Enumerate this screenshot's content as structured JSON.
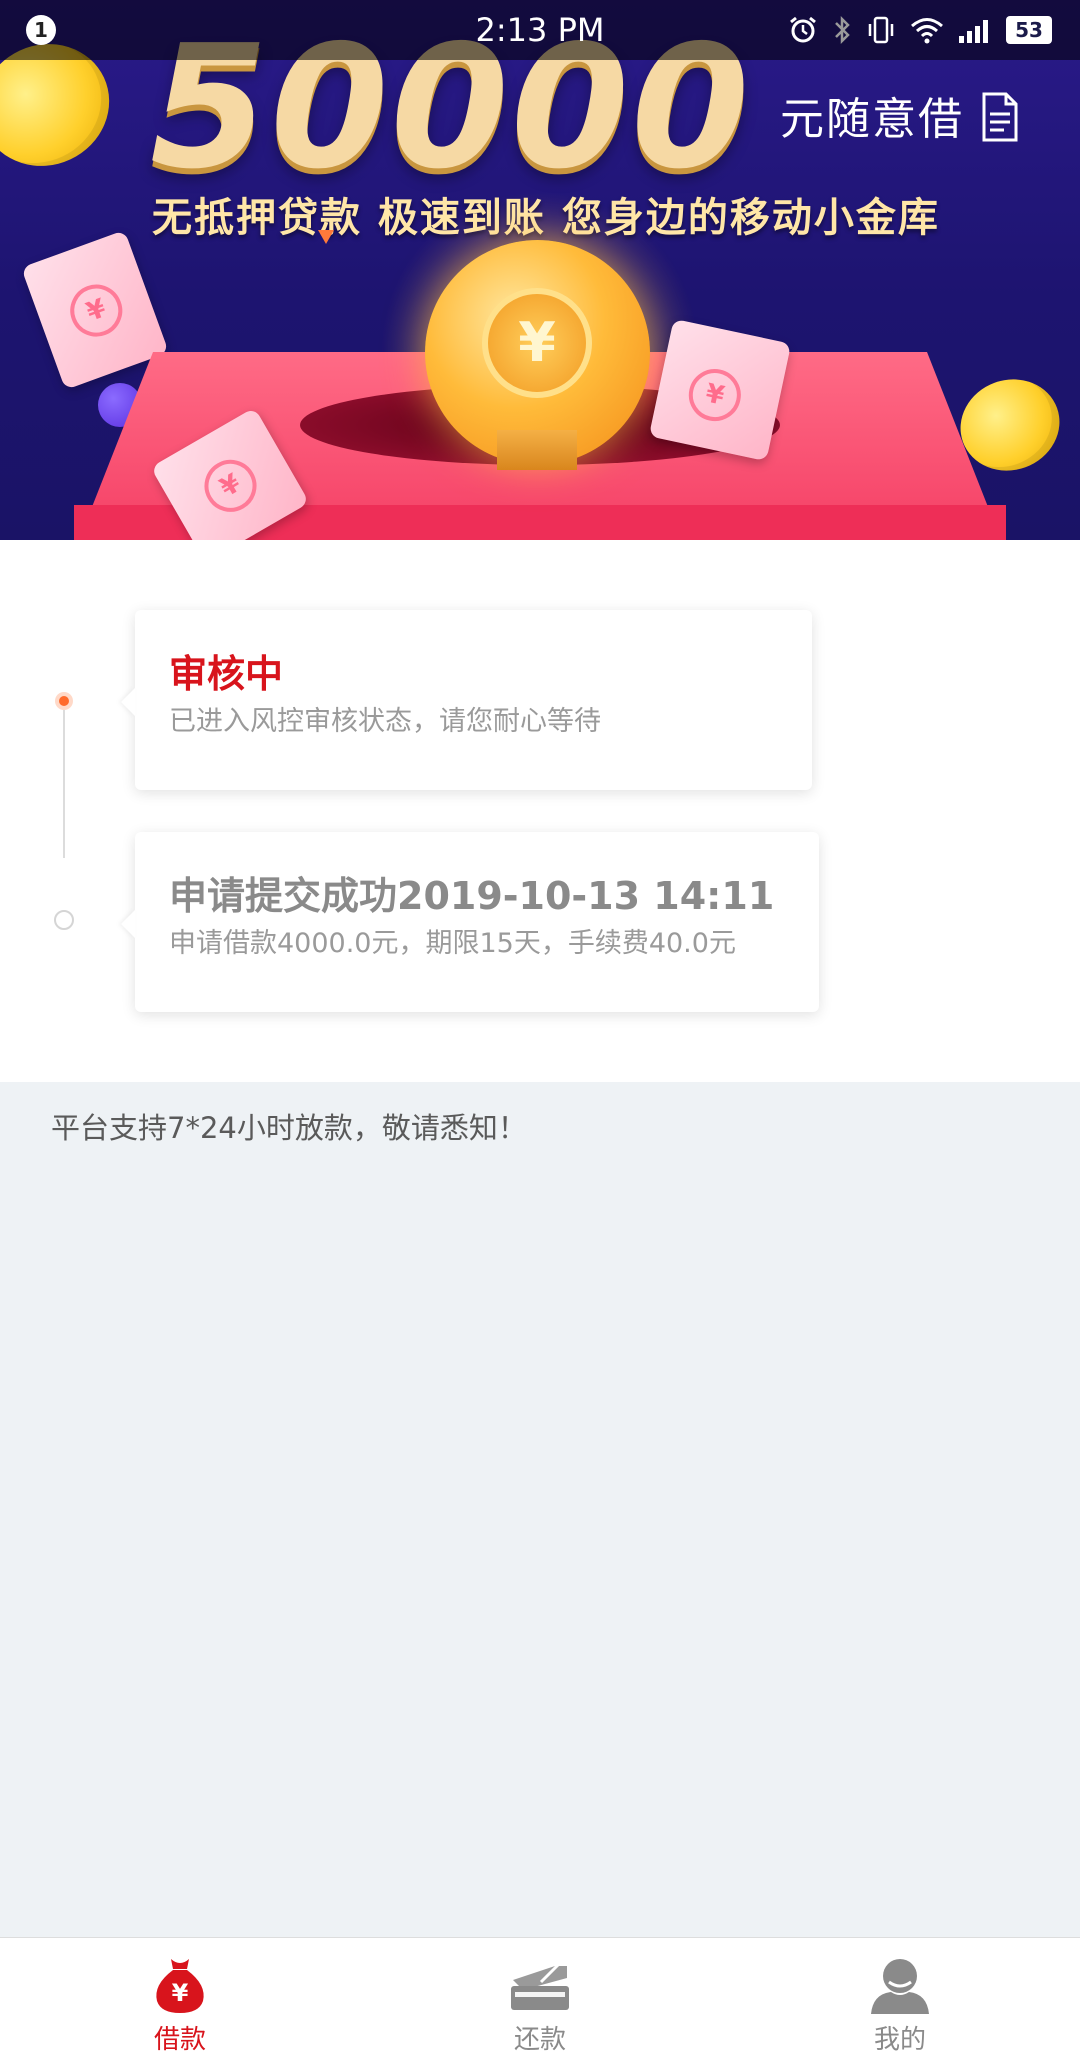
{
  "status_bar": {
    "notification_count": "1",
    "time": "2:13 PM",
    "battery": "53"
  },
  "banner": {
    "amount": "50000",
    "amount_suffix": "元随意借",
    "slogan": "无抵押贷款 极速到账  您身边的移动小金库",
    "coin_symbol": "¥",
    "bill_symbol": "¥"
  },
  "timeline": {
    "steps": [
      {
        "title": "审核中",
        "description": "已进入风控审核状态，请您耐心等待",
        "state": "active",
        "color": "#d8141c"
      },
      {
        "title": "申请提交成功2019-10-13 14:11",
        "description": "申请借款4000.0元，期限15天，手续费40.0元",
        "state": "done",
        "color": "#8a8a8a"
      }
    ]
  },
  "notice": "平台支持7*24小时放款，敬请悉知！",
  "bottom_nav": {
    "items": [
      {
        "label": "借款",
        "icon": "money-bag-icon",
        "active": true
      },
      {
        "label": "还款",
        "icon": "card-pay-icon",
        "active": false
      },
      {
        "label": "我的",
        "icon": "user-icon",
        "active": false
      }
    ],
    "active_color": "#d8141c",
    "inactive_color": "#8a8a8a"
  }
}
